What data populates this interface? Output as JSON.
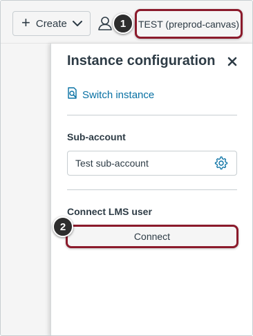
{
  "topbar": {
    "create_label": "Create",
    "create_icon": "plus-icon",
    "dropdown_icon": "chevron-down-icon",
    "user_icon": "user-icon",
    "instance_label": "TEST (preprod-canvas)"
  },
  "callouts": [
    "1",
    "2"
  ],
  "panel": {
    "title": "Instance configuration",
    "close_icon": "close-icon",
    "switch_instance_label": "Switch instance",
    "switch_instance_icon": "search-document-icon",
    "subaccount_heading": "Sub-account",
    "subaccount_value": "Test sub-account",
    "subaccount_settings_icon": "gear-icon",
    "lms_heading": "Connect LMS user",
    "connect_label": "Connect"
  },
  "colors": {
    "link": "#0770a3",
    "highlight_border": "#8b1a2b",
    "text": "#2d3b45",
    "callout_bg": "#2d2d2d"
  }
}
